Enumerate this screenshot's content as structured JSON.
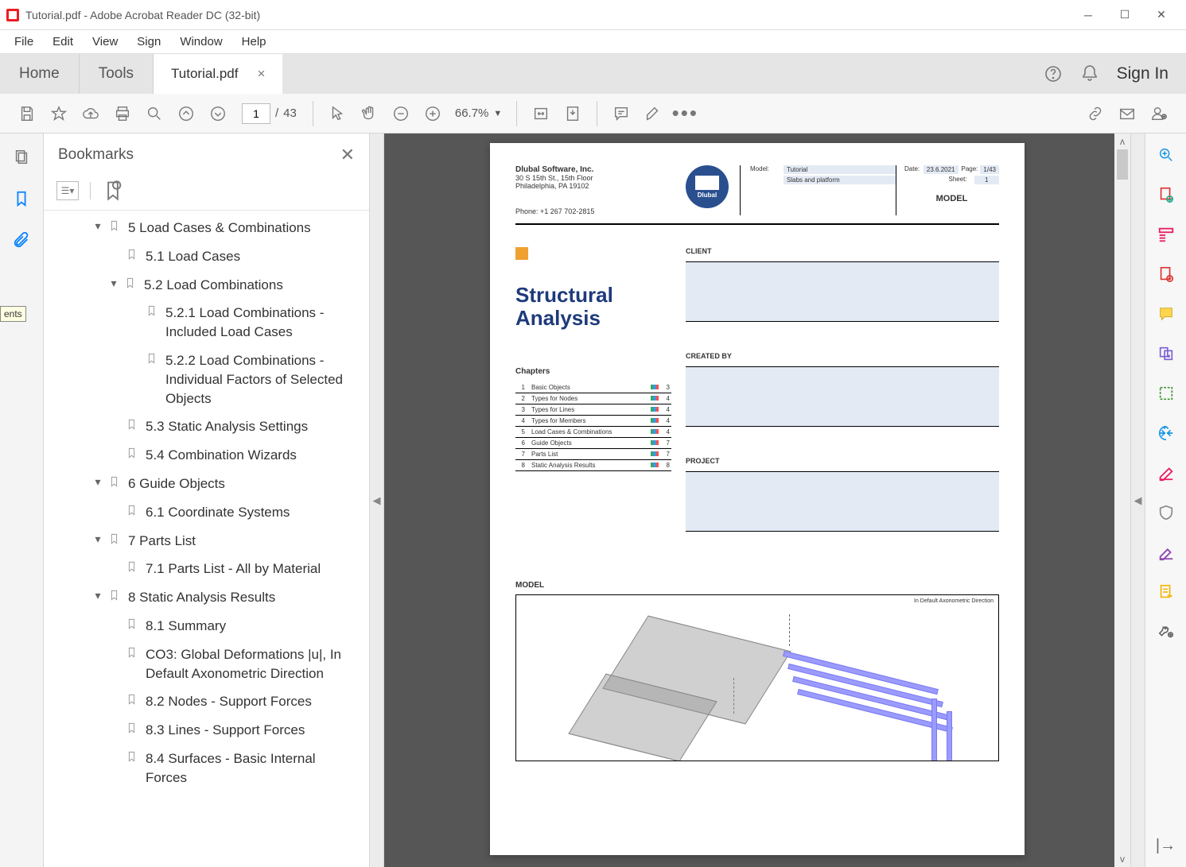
{
  "window": {
    "title": "Tutorial.pdf - Adobe Acrobat Reader DC (32-bit)"
  },
  "menu": [
    "File",
    "Edit",
    "View",
    "Sign",
    "Window",
    "Help"
  ],
  "tabs": {
    "home": "Home",
    "tools": "Tools",
    "doc": "Tutorial.pdf",
    "signin": "Sign In"
  },
  "toolbar": {
    "page_current": "1",
    "page_sep": "/",
    "page_total": "43",
    "zoom": "66.7%"
  },
  "bookmarks": {
    "title": "Bookmarks",
    "items": [
      {
        "text": "5 Load Cases & Combinations",
        "indent": "ind0c",
        "chev": "▾"
      },
      {
        "text": "5.1 Load Cases",
        "indent": "ind1",
        "chev": ""
      },
      {
        "text": "5.2 Load Combinations",
        "indent": "ind1c",
        "chev": "▾"
      },
      {
        "text": "5.2.1 Load Combinations - Included Load Cases",
        "indent": "ind2",
        "chev": ""
      },
      {
        "text": "5.2.2 Load Combinations - Individual Factors of Selected Objects",
        "indent": "ind2",
        "chev": ""
      },
      {
        "text": "5.3 Static Analysis Settings",
        "indent": "ind1",
        "chev": ""
      },
      {
        "text": "5.4 Combination Wizards",
        "indent": "ind1",
        "chev": ""
      },
      {
        "text": "6 Guide Objects",
        "indent": "ind0c",
        "chev": "▾"
      },
      {
        "text": "6.1 Coordinate Systems",
        "indent": "ind1",
        "chev": ""
      },
      {
        "text": "7 Parts List",
        "indent": "ind0c",
        "chev": "▾"
      },
      {
        "text": "7.1 Parts List - All by Material",
        "indent": "ind1",
        "chev": ""
      },
      {
        "text": "8 Static Analysis Results",
        "indent": "ind0c",
        "chev": "▾"
      },
      {
        "text": "8.1 Summary",
        "indent": "ind1",
        "chev": ""
      },
      {
        "text": "CO3: Global Deformations |u|, In Default Axonometric Direction",
        "indent": "ind1",
        "chev": ""
      },
      {
        "text": "8.2 Nodes - Support Forces",
        "indent": "ind1",
        "chev": ""
      },
      {
        "text": "8.3 Lines - Support Forces",
        "indent": "ind1",
        "chev": ""
      },
      {
        "text": "8.4 Surfaces - Basic Internal Forces",
        "indent": "ind1",
        "chev": ""
      }
    ]
  },
  "doc": {
    "company": "Dlubal Software, Inc.",
    "addr1": "30 S 15th St., 15th Floor",
    "addr2": "Philadelphia, PA 19102",
    "phone": "Phone: +1 267 702-2815",
    "meta": {
      "model_lbl": "Model:",
      "model_val": "Tutorial",
      "model_sub": "Slabs and platform",
      "date_lbl": "Date:",
      "date_val": "23.6.2021",
      "page_lbl": "Page:",
      "page_val": "1/43",
      "sheet_lbl": "Sheet:",
      "sheet_val": "1",
      "model_big": "MODEL"
    },
    "title": "Structural Analysis",
    "chap_hdr": "Chapters",
    "chapters": [
      {
        "n": "1",
        "t": "Basic Objects",
        "p": "3"
      },
      {
        "n": "2",
        "t": "Types for Nodes",
        "p": "4"
      },
      {
        "n": "3",
        "t": "Types for Lines",
        "p": "4"
      },
      {
        "n": "4",
        "t": "Types for Members",
        "p": "4"
      },
      {
        "n": "5",
        "t": "Load Cases & Combinations",
        "p": "4"
      },
      {
        "n": "6",
        "t": "Guide Objects",
        "p": "7"
      },
      {
        "n": "7",
        "t": "Parts List",
        "p": "7"
      },
      {
        "n": "8",
        "t": "Static Analysis Results",
        "p": "8"
      }
    ],
    "sections": {
      "client": "CLIENT",
      "created": "CREATED BY",
      "project": "PROJECT"
    },
    "model_hdr": "MODEL",
    "model_note": "In Default Axonometric Direction"
  },
  "tooltip": "ents"
}
